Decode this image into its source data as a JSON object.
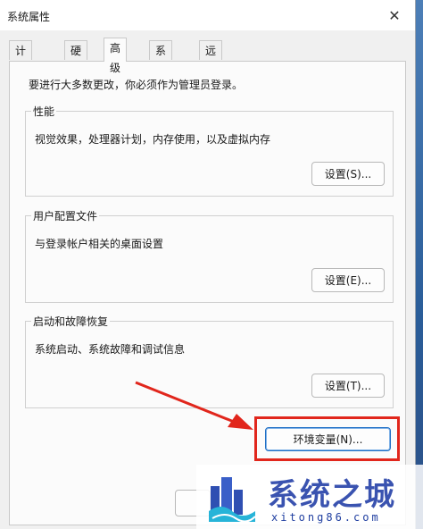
{
  "window": {
    "title": "系统属性",
    "close_icon": "close-icon"
  },
  "tabs": [
    {
      "label": "计算机名"
    },
    {
      "label": "硬件"
    },
    {
      "label": "高级",
      "active": true
    },
    {
      "label": "系统保护"
    },
    {
      "label": "远程"
    }
  ],
  "advanced": {
    "admin_note": "要进行大多数更改，你必须作为管理员登录。",
    "performance": {
      "legend": "性能",
      "description": "视觉效果，处理器计划，内存使用，以及虚拟内存",
      "button": "设置(S)..."
    },
    "user_profiles": {
      "legend": "用户配置文件",
      "description": "与登录帐户相关的桌面设置",
      "button": "设置(E)..."
    },
    "startup_recovery": {
      "legend": "启动和故障恢复",
      "description": "系统启动、系统故障和调试信息",
      "button": "设置(T)..."
    },
    "env_button": "环境变量(N)..."
  },
  "watermark": {
    "title": "系统之城",
    "url": "xitong86.com"
  },
  "colors": {
    "annotation_red": "#e1261c",
    "watermark_blue": "#3a53b0",
    "desktop_blue": "#2a5d99"
  }
}
